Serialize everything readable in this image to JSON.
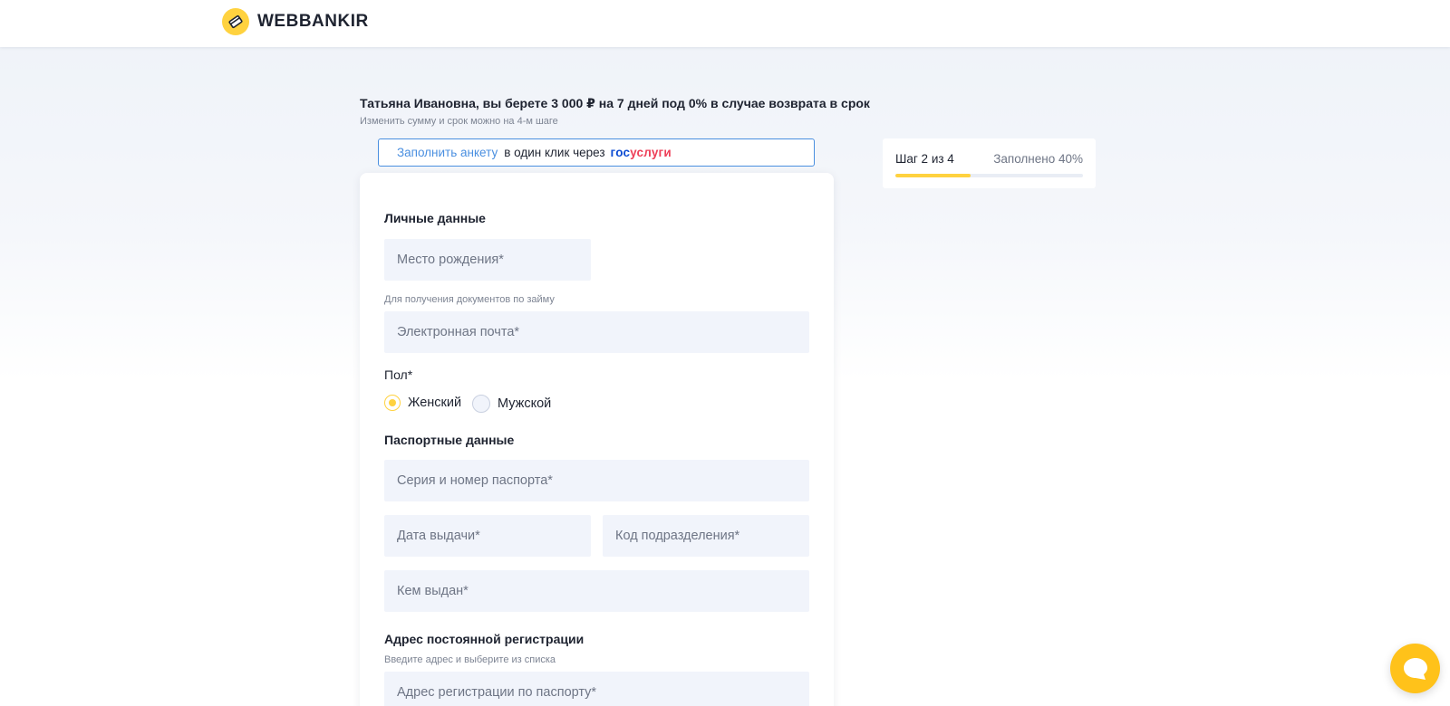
{
  "brand": {
    "name": "WEBBANKIR",
    "accent": "#ffd23f"
  },
  "hero": {
    "title": "Татьяна Ивановна, вы берете 3 000 ₽ на 7 дней под 0% в случае возврата в срок",
    "subtitle": "Изменить сумму и срок можно на 4-м шаге"
  },
  "gosuslugi": {
    "link_label": "Заполнить анкету",
    "text": "в один клик через",
    "logo_part1": "гос",
    "logo_part2": "услуги"
  },
  "progress": {
    "step_label": "Шаг 2 из 4",
    "filled_label": "Заполнено 40%",
    "fraction": 0.4
  },
  "form": {
    "personal": {
      "title": "Личные данные",
      "birthplace_placeholder": "Место рождения*",
      "email_hint": "Для получения документов по займу",
      "email_placeholder": "Электронная почта*",
      "gender_label": "Пол*",
      "gender_options": [
        "Женский",
        "Мужской"
      ],
      "gender_selected": "Женский"
    },
    "passport": {
      "title": "Паспортные данные",
      "series_placeholder": "Серия и номер паспорта*",
      "issue_date_placeholder": "Дата выдачи*",
      "division_code_placeholder": "Код подразделения*",
      "issued_by_placeholder": "Кем выдан*"
    },
    "registration": {
      "title": "Адрес постоянной регистрации",
      "hint": "Введите адрес и выберите из списка",
      "address_placeholder": "Адрес регистрации по паспорту*"
    }
  },
  "icons": {
    "logo": "webbankir-logo-icon",
    "chat": "chat-bubble-icon"
  }
}
